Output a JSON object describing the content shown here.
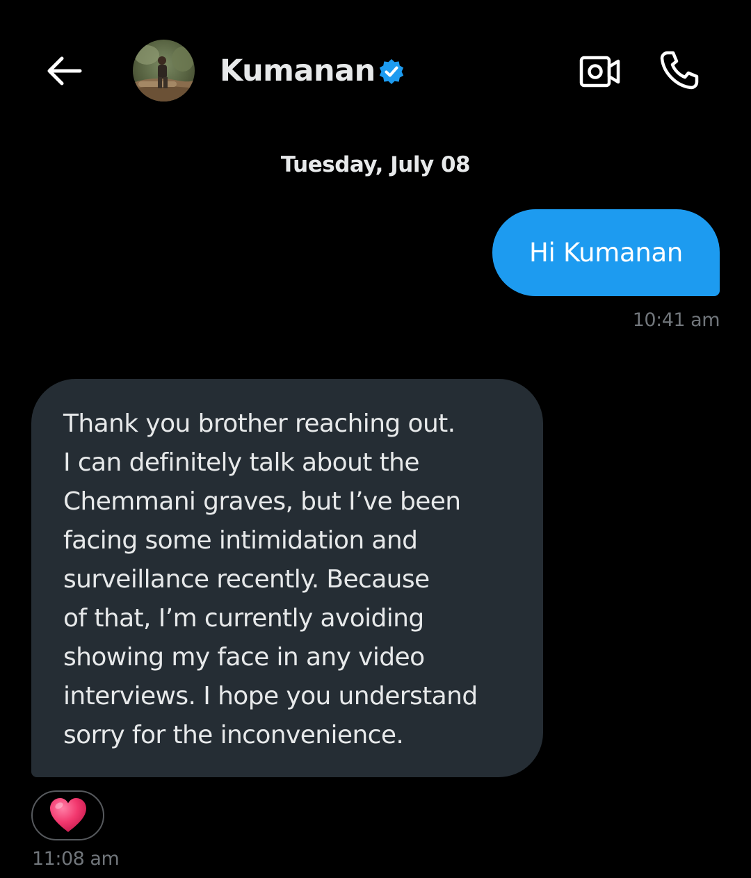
{
  "header": {
    "contact_name": "Kumanan",
    "verified": true,
    "accent_color": "#1d9bf0",
    "icons": {
      "back": "back-arrow-icon",
      "verified": "verified-badge-icon",
      "video": "video-call-icon",
      "call": "phone-call-icon"
    }
  },
  "conversation": {
    "date_separator": "Tuesday, July 08",
    "messages": [
      {
        "direction": "outgoing",
        "text": "Hi Kumanan",
        "time": "10:41 am",
        "bubble_color": "#1d9bf0"
      },
      {
        "direction": "incoming",
        "text": "Thank you brother reaching out.\nI can definitely talk about the\nChemmani graves, but I’ve been\nfacing some intimidation and\nsurveillance recently. Because\nof that, I’m currently avoiding\nshowing my face in any video\ninterviews. I hope you understand\nsorry for the inconvenience.",
        "time": "11:08 am",
        "bubble_color": "#252d34",
        "reaction": "heart-emoji-icon"
      }
    ]
  }
}
